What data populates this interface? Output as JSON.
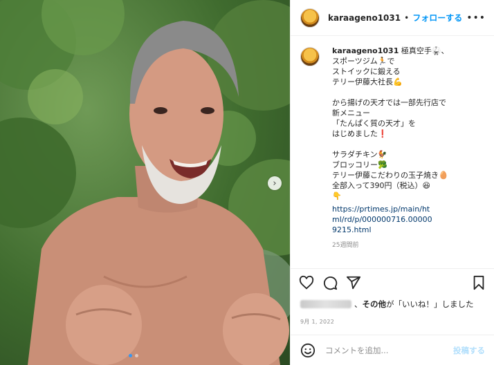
{
  "header": {
    "username": "karaageno1031",
    "separator": "•",
    "follow_label": "フォローする",
    "more_label": "•••"
  },
  "caption": {
    "username": "karaageno1031",
    "lines": [
      "極真空手🥋、",
      "スポーツジム🏃で",
      "ストイックに鍛える",
      "テリー伊藤大社長💪",
      "",
      "から揚げの天才では一部先行店で",
      "新メニュー",
      "「たんぱく質の天才」を",
      "はじめました❗",
      "",
      "サラダチキン🐓",
      "ブロッコリー🥦",
      "テリー伊藤こだわりの玉子焼き🥚",
      "全部入って390円（税込）😆",
      "👇"
    ],
    "link": "https://prtimes.jp/main/html/rd/p/000000716.000009215.html",
    "time": "25週間前"
  },
  "likes": {
    "text_suffix": "、",
    "others_label": "その他",
    "liked_text": "が「いいね！」しました"
  },
  "date": "9月 1, 2022",
  "comment": {
    "placeholder": "コメントを追加...",
    "post_label": "投稿する"
  },
  "carousel": {
    "slides": 2,
    "active": 1
  },
  "colors": {
    "accent": "#0095f6",
    "post_disabled": "#b2dffc",
    "muted": "#8e8e8e"
  }
}
